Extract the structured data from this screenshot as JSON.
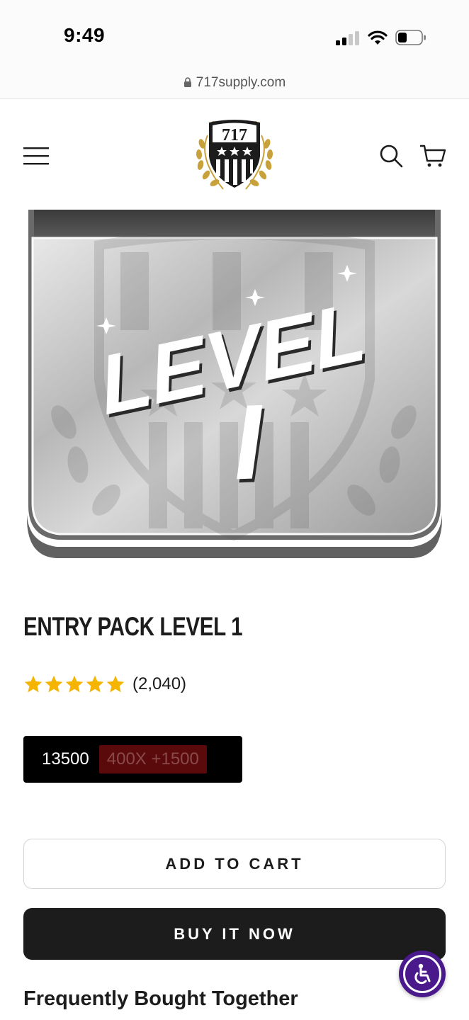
{
  "status_bar": {
    "time": "9:49"
  },
  "browser": {
    "url": "717supply.com"
  },
  "header": {
    "logo_text": "717",
    "menu_icon": "hamburger-menu-icon",
    "search_icon": "search-icon",
    "cart_icon": "cart-icon"
  },
  "product": {
    "image_text_line1": "LEVEL",
    "image_text_line2": "I",
    "title": "ENTRY PACK LEVEL 1",
    "rating_stars": 5,
    "rating_count": "(2,040)",
    "variants": [
      {
        "label": "13500",
        "available": true
      },
      {
        "label": "400X +1500",
        "available": false
      }
    ],
    "add_to_cart_label": "ADD TO CART",
    "buy_now_label": "BUY IT NOW"
  },
  "sections": {
    "frequently_bought_heading": "Frequently Bought Together"
  },
  "colors": {
    "star": "#f4b400",
    "buy_button": "#1c1c1c",
    "variant_unavailable_bg": "#5a0a0a",
    "accessibility": "#4a1a8c",
    "logo_gold": "#c9a13b"
  }
}
